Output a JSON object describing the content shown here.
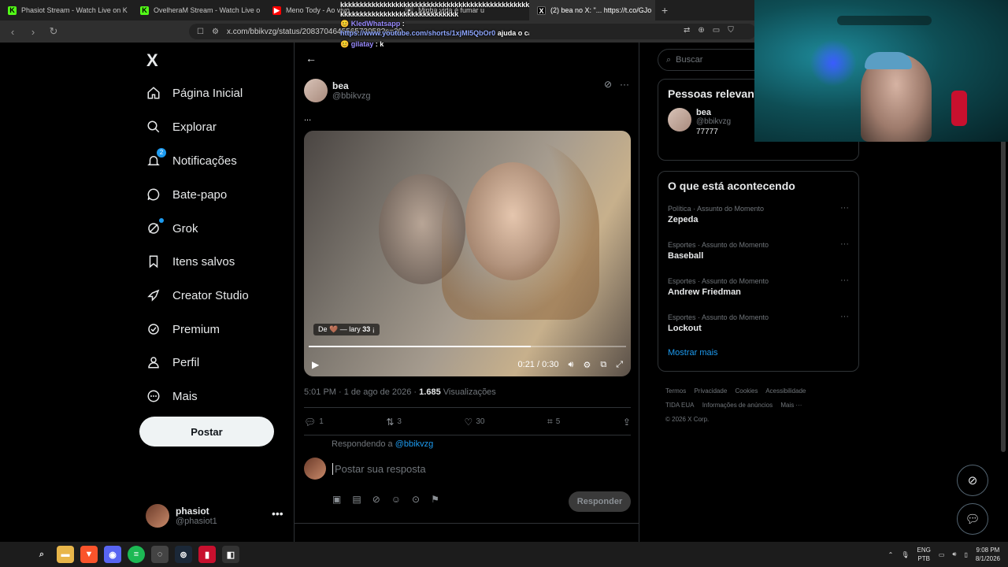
{
  "browser": {
    "tabs": [
      {
        "label": "Phasiot Stream - Watch Live on K",
        "fav_color": "#53fc18",
        "fav_glyph": "K",
        "active": false
      },
      {
        "label": "OvelheraM Stream - Watch Live o",
        "fav_color": "#53fc18",
        "fav_glyph": "K",
        "active": false
      },
      {
        "label": "Meno Tody - Ao vivo",
        "fav_color": "#ff0000",
        "fav_glyph": "▶",
        "active": false
      },
      {
        "label": "Minha vida é fumar u",
        "fav_color": "#444444",
        "fav_glyph": "•",
        "active": false
      },
      {
        "label": "(2) bea no X: \"... https://t.co/GJo",
        "fav_color": "#ffffff",
        "fav_glyph": "X",
        "active": true
      }
    ],
    "url": "x.com/bbikvzg/status/208370464556573058?s=20",
    "new_tab": "+"
  },
  "chat": {
    "spam": "kkkkkkkkkkkkkkkkkkkkkkkkkkkkkkkkkkkkkkkkkkkkkkkkkkkkkkkk",
    "spam2": "kkkkkkkkkkkkkkkkkkkkkkkkkkkkkk",
    "user1": "KledWhatsapp",
    "link": "https://www.youtube.com/shorts/1xjMI5QbOr0",
    "msg1": "ajuda o cara ai fi, foi parado pela polica kkkkkkk",
    "user2": "gilatay",
    "msg2": "k"
  },
  "sidebar": {
    "logo": "X",
    "items": [
      {
        "label": "Página Inicial",
        "icon": "home-icon"
      },
      {
        "label": "Explorar",
        "icon": "search-icon"
      },
      {
        "label": "Notificações",
        "icon": "bell-icon",
        "badge": "2"
      },
      {
        "label": "Bate-papo",
        "icon": "chat-icon"
      },
      {
        "label": "Grok",
        "icon": "grok-icon"
      },
      {
        "label": "Itens salvos",
        "icon": "bookmark-icon"
      },
      {
        "label": "Creator Studio",
        "icon": "rocket-icon"
      },
      {
        "label": "Premium",
        "icon": "verified-icon"
      },
      {
        "label": "Perfil",
        "icon": "person-icon"
      },
      {
        "label": "Mais",
        "icon": "more-circle-icon"
      }
    ],
    "post_button": "Postar",
    "account": {
      "name": "phasiot",
      "handle": "@phasiot1",
      "more": "•••"
    }
  },
  "post": {
    "author_name": "bea",
    "author_handle": "@bbikvzg",
    "text": "...",
    "video": {
      "credit": "De 🤎 — lary 𝟑𝟑 ¡",
      "time": "0:21 / 0:30",
      "progress": 0.7
    },
    "timestamp": "5:01 PM · 1 de ago de 2026 · ",
    "views_count": "1.685",
    "views_label": " Visualizações",
    "actions": {
      "replies": "1",
      "reposts": "3",
      "likes": "30",
      "bookmarks": "5"
    },
    "replying_to_label": "Respondendo a ",
    "replying_to_handle": "@bbikvzg",
    "reply_placeholder": "Postar sua resposta",
    "reply_button": "Responder"
  },
  "right": {
    "search_placeholder": "Buscar",
    "relevant_title": "Pessoas relevantes",
    "relevant_person": {
      "name": "bea",
      "handle": "@bbikvzg",
      "bio": "77777"
    },
    "trends_title": "O que está acontecendo",
    "trends": [
      {
        "category": "Política · Assunto do Momento",
        "name": "Zepeda"
      },
      {
        "category": "Esportes · Assunto do Momento",
        "name": "Baseball"
      },
      {
        "category": "Esportes · Assunto do Momento",
        "name": "Andrew Friedman"
      },
      {
        "category": "Esportes · Assunto do Momento",
        "name": "Lockout"
      }
    ],
    "show_more": "Mostrar mais",
    "footer": [
      "Termos",
      "Privacidade",
      "Cookies",
      "Acessibilidade",
      "TIDA EUA",
      "Informações de anúncios",
      "Mais ···",
      "© 2026 X Corp."
    ]
  },
  "taskbar": {
    "lang": "ENG",
    "lang2": "PTB",
    "time": "9:08 PM",
    "date": "8/1/2026"
  }
}
